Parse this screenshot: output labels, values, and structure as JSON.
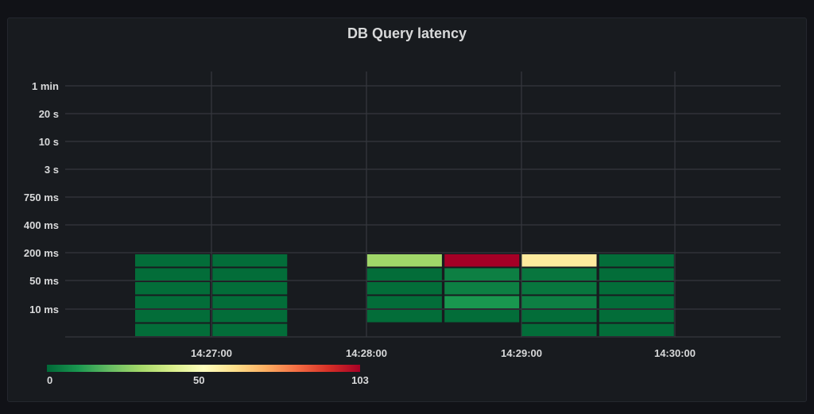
{
  "panel": {
    "title": "DB Query latency"
  },
  "chart_data": {
    "type": "heatmap",
    "title": "DB Query latency",
    "x_tick_labels": [
      "14:27:00",
      "14:28:00",
      "14:29:00",
      "14:30:00"
    ],
    "y_tick_labels": [
      "1 min",
      "20 s",
      "10 s",
      "3 s",
      "750 ms",
      "400 ms",
      "200 ms",
      "50 ms",
      "10 ms"
    ],
    "x_buckets": [
      "14:26:30",
      "14:27:00",
      "14:27:30",
      "14:28:00",
      "14:28:30",
      "14:29:00",
      "14:29:30"
    ],
    "y_bucket_tops": [
      "200 ms",
      "100 ms",
      "50 ms",
      "25 ms",
      "10 ms",
      "5 ms"
    ],
    "cells": [
      [
        1,
        1,
        1,
        1,
        1,
        1
      ],
      [
        1,
        1,
        1,
        1,
        1,
        1
      ],
      [
        null,
        null,
        null,
        null,
        null,
        null
      ],
      [
        null,
        1,
        1,
        1,
        1,
        30
      ],
      [
        null,
        1,
        10,
        5,
        5,
        103
      ],
      [
        1,
        1,
        5,
        3,
        3,
        58
      ],
      [
        1,
        1,
        1,
        1,
        1,
        1
      ]
    ],
    "color_scale": {
      "scheme": "RdYlGn-reversed",
      "min": 0,
      "max": 103,
      "ticks": [
        "0",
        "50",
        "103"
      ],
      "stops": [
        "#006837",
        "#1a9850",
        "#66bd63",
        "#a6d96a",
        "#d9ef8b",
        "#ffffbf",
        "#fee08b",
        "#fdae61",
        "#f46d43",
        "#d73027",
        "#a50026"
      ]
    },
    "grid": true,
    "legend": "bottom-left"
  }
}
